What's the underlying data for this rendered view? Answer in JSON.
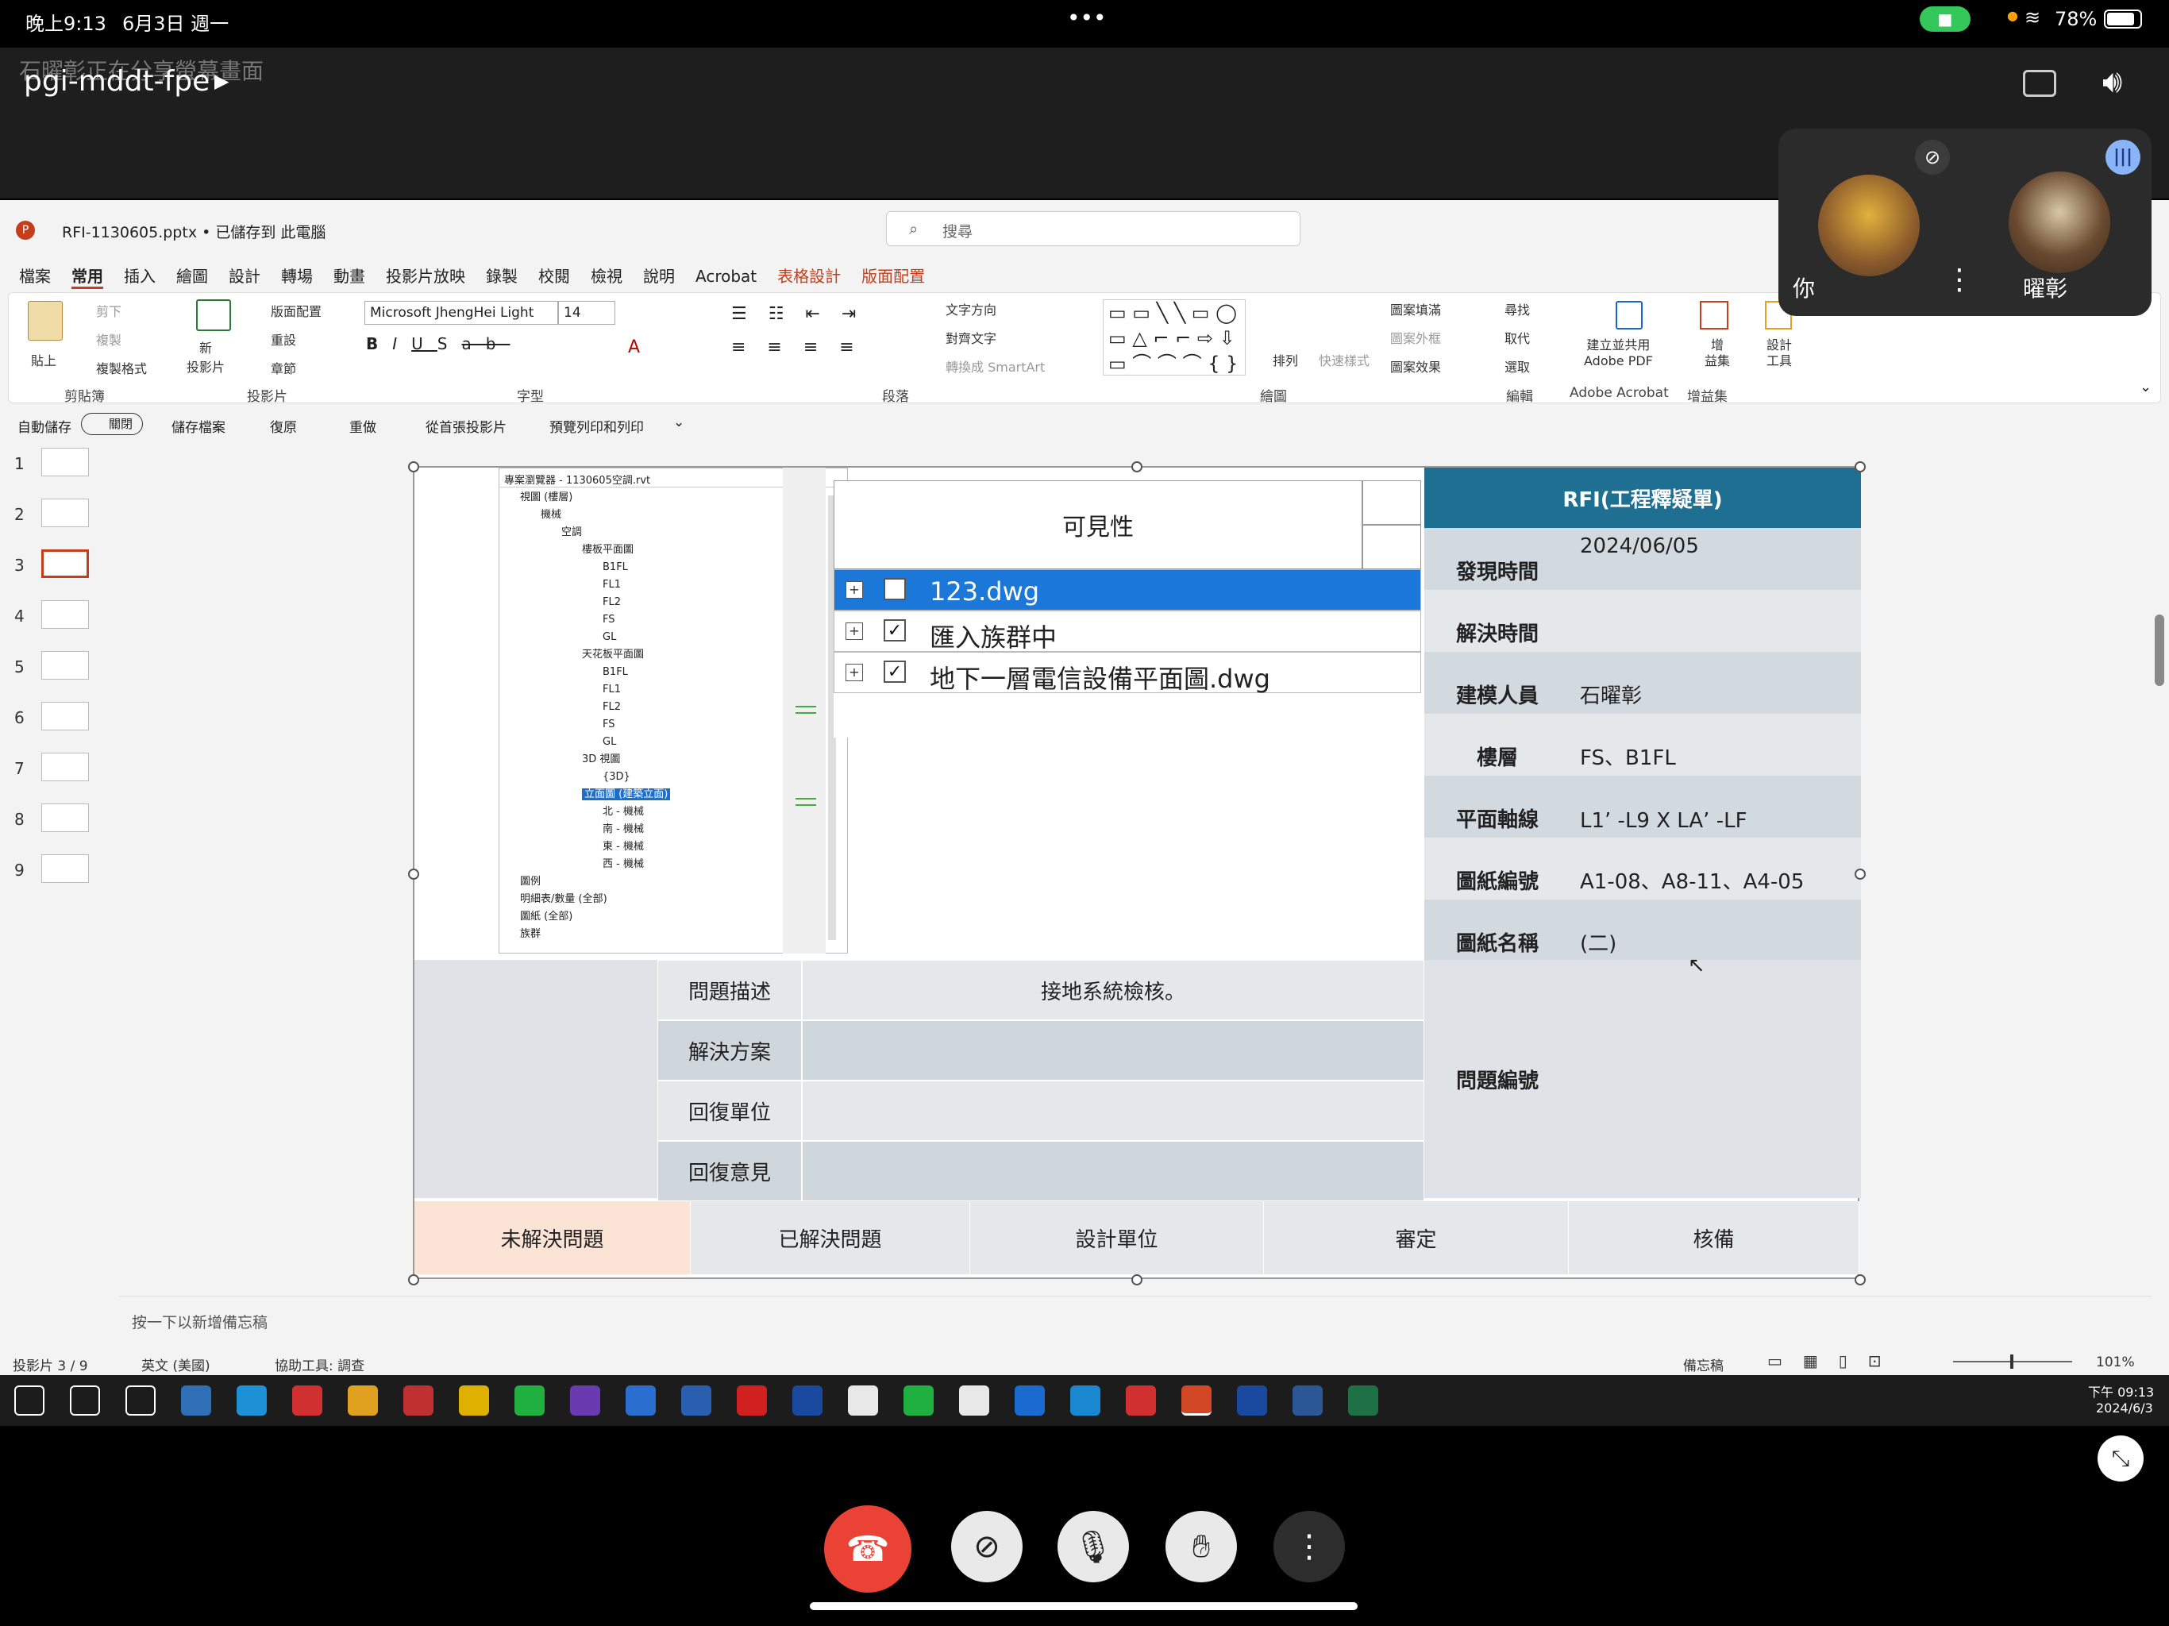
{
  "statusbar": {
    "time": "晚上9:13",
    "date": "6月3日 週一",
    "battery": "78%"
  },
  "meeting": {
    "sharing_notice": "石曜彰正在分享螢幕畫面",
    "meeting_code": "pgi-mddt-fpe",
    "self_label": "你",
    "other_label": "曜彰"
  },
  "ppt": {
    "filename": "RFI-1130605.pptx • 已儲存到 此電腦",
    "search_placeholder": "搜尋",
    "tabs": [
      "檔案",
      "常用",
      "插入",
      "繪圖",
      "設計",
      "轉場",
      "動畫",
      "投影片放映",
      "錄製",
      "校閱",
      "檢視",
      "說明",
      "Acrobat",
      "表格設計",
      "版面配置"
    ],
    "ribbon": {
      "paste": "貼上",
      "cut": "剪下",
      "copy": "複製",
      "format_painter": "複製格式",
      "clipboard": "剪貼簿",
      "new_slide": "新\n投影片",
      "layout": "版面配置",
      "reset": "重設",
      "section": "章節",
      "slides_group": "投影片",
      "font_name": "Microsoft JhengHei Light",
      "font_size": "14",
      "font_group": "字型",
      "text_direction": "文字方向",
      "align_text": "對齊文字",
      "smartart": "轉換成 SmartArt",
      "paragraph_group": "段落",
      "arrange": "排列",
      "quick_styles": "快速樣式",
      "shape_fill": "圖案填滿",
      "shape_outline": "圖案外框",
      "shape_effects": "圖案效果",
      "drawing_group": "繪圖",
      "find": "尋找",
      "replace": "取代",
      "select": "選取",
      "editing_group": "編輯",
      "adobe_pdf": "建立並共用\nAdobe PDF",
      "adobe_group": "Adobe Acrobat",
      "addins": "增\n益集",
      "addins_group": "增益集",
      "designer": "設計\n工具"
    },
    "qat": {
      "autosave": "自動儲存",
      "autosave_state": "關閉",
      "save": "儲存檔案",
      "undo": "復原",
      "redo": "重做",
      "from_start": "從首張投影片",
      "print_preview": "預覽列印和列印"
    },
    "slide_numbers": [
      "1",
      "2",
      "3",
      "4",
      "5",
      "6",
      "7",
      "8",
      "9"
    ],
    "notes_placeholder": "按一下以新增備忘稿",
    "statusbar": {
      "slide": "投影片 3 / 9",
      "lang": "英文 (美國)",
      "accessibility": "協助工具: 調查",
      "notes": "備忘稿",
      "zoom": "101%"
    }
  },
  "slide": {
    "project_browser": {
      "title": "專案瀏覽器 - 1130605空調.rvt",
      "items": [
        "視圖 (樓層)",
        "機械",
        "空調",
        "樓板平面圖",
        "B1FL",
        "FL1",
        "FL2",
        "FS",
        "GL",
        "天花板平面圖",
        "B1FL",
        "FL1",
        "FL2",
        "FS",
        "GL",
        "3D 視圖",
        "{3D}",
        "立面圖 (建築立面)",
        "北 - 機械",
        "南 - 機械",
        "東 - 機械",
        "西 - 機械",
        "圖例",
        "明細表/數量 (全部)",
        "圖紙 (全部)",
        "族群"
      ]
    },
    "visibility": {
      "header": "可見性",
      "rows": [
        "123.dwg",
        "匯入族群中",
        "地下一層電信設備平面圖.dwg"
      ]
    },
    "rfi": {
      "title": "RFI(工程釋疑單)",
      "labels": [
        "發現時間",
        "解決時間",
        "建模人員",
        "樓層",
        "平面軸線",
        "圖紙編號",
        "圖紙名稱",
        "問題編號"
      ],
      "values": [
        "2024/06/05",
        "",
        "石曜彰",
        "FS、B1FL",
        "L1’ -L9 X LA’ -LF",
        "A1-08、A8-11、A4-05",
        "(二)",
        ""
      ]
    },
    "problem": {
      "labels": [
        "問題描述",
        "解決方案",
        "回復單位",
        "回復意見"
      ],
      "values": [
        "接地系統檢核。",
        "",
        "",
        ""
      ]
    },
    "bottom": [
      "未解決問題",
      "已解決問題",
      "設計單位",
      "審定",
      "核備"
    ]
  },
  "taskbar": {
    "time": "下午 09:13",
    "date": "2024/6/3"
  }
}
